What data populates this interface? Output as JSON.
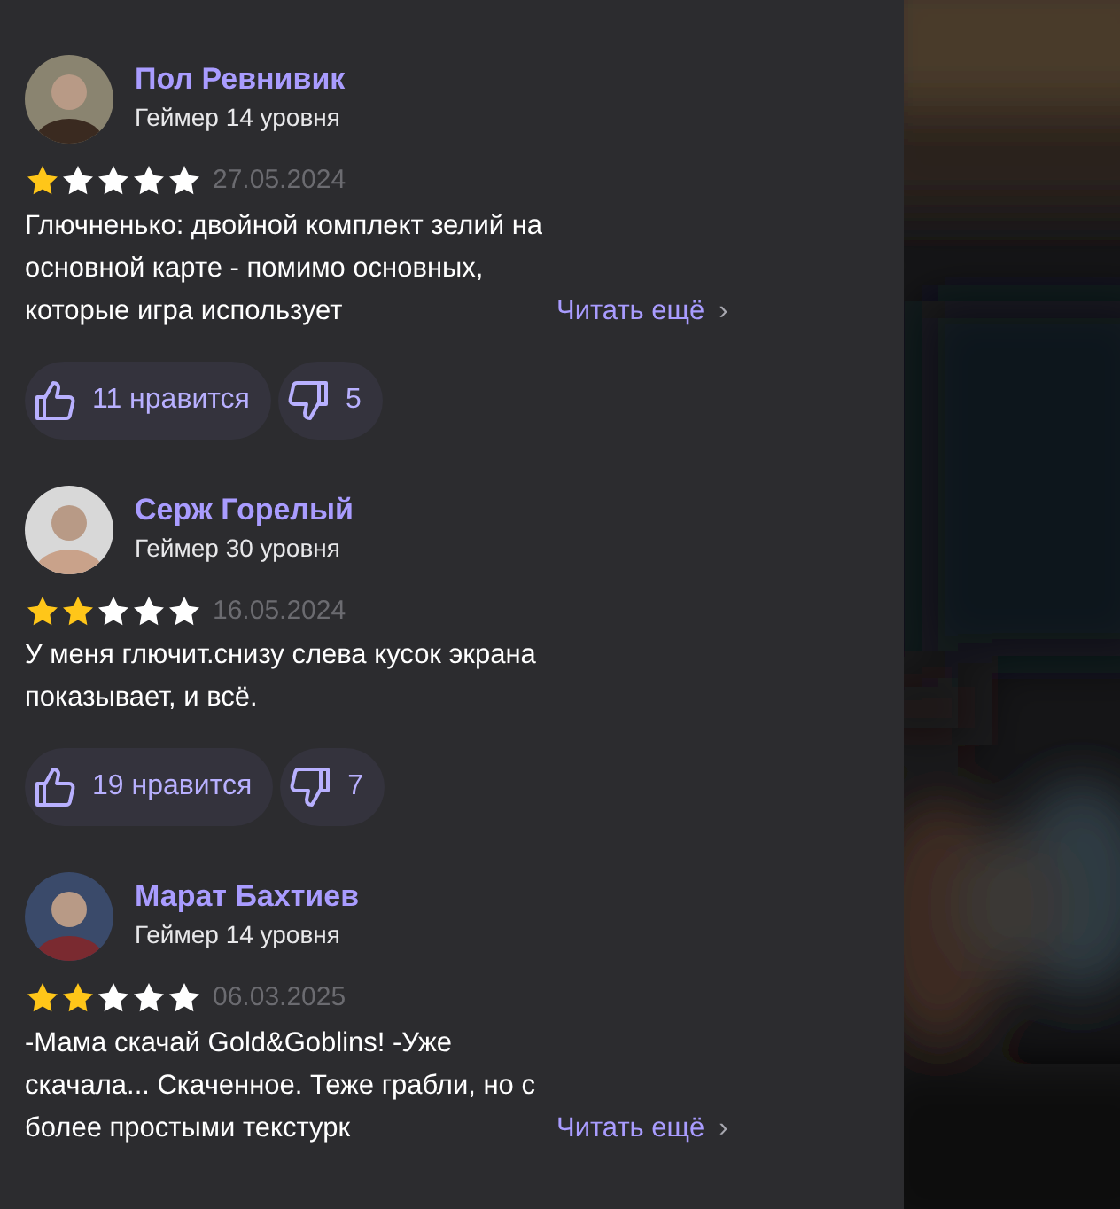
{
  "reviews": [
    {
      "author": "Пол Ревнивик",
      "level": "Геймер 14 уровня",
      "stars": 1,
      "date": "27.05.2024",
      "text": "Глючненько: двойной комплект зелий на основной карте - помимо основных, которые игра использует",
      "read_more": {
        "label": "Читать ещё",
        "chevron": "›"
      },
      "likes": "11 нравится",
      "dislikes": "5"
    },
    {
      "author": "Серж Горелый",
      "level": "Геймер 30 уровня",
      "stars": 2,
      "date": "16.05.2024",
      "text": "У меня глючит.снизу слева кусок экрана показывает, и всё.",
      "likes": "19 нравится",
      "dislikes": "7"
    },
    {
      "author": "Марат Бахтиев",
      "level": "Геймер 14 уровня",
      "stars": 2,
      "date": "06.03.2025",
      "text": "-Мама скачай Gold&Goblins! -Уже скачала... Скаченное. Теже грабли, но с более простыми текстурк",
      "read_more": {
        "label": "Читать ещё",
        "chevron": "›"
      }
    }
  ]
}
